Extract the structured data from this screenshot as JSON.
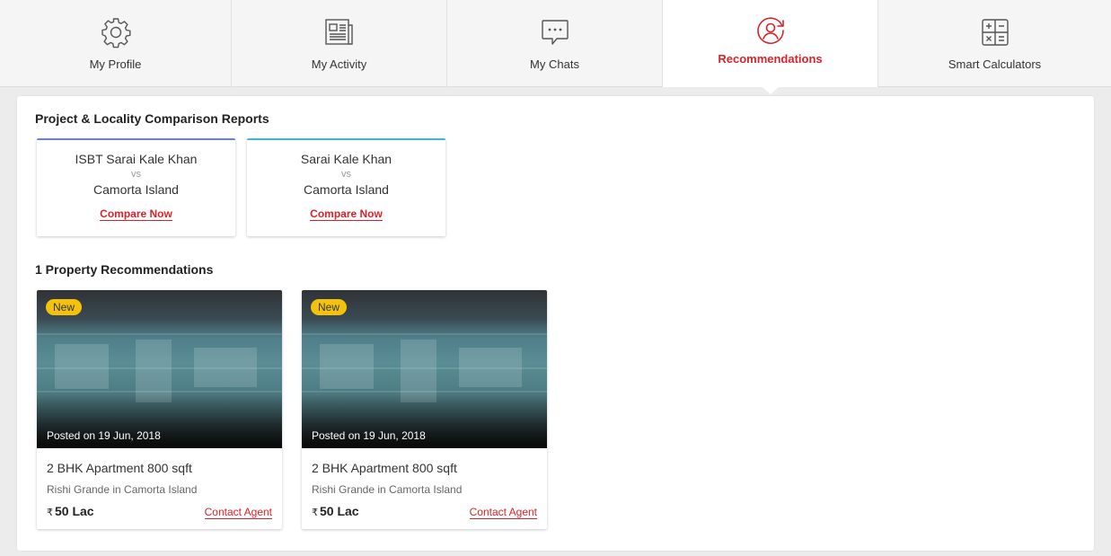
{
  "tabs": [
    {
      "label": "My Profile",
      "icon": "gear-icon"
    },
    {
      "label": "My Activity",
      "icon": "newspaper-icon"
    },
    {
      "label": "My Chats",
      "icon": "chat-bubble-icon"
    },
    {
      "label": "Recommendations",
      "icon": "user-refresh-icon",
      "active": true
    },
    {
      "label": "Smart Calculators",
      "icon": "calculator-icon"
    }
  ],
  "colors": {
    "accent": "#d8232a",
    "badge": "#f4c20d",
    "compare_bar_1": "#6f7fc8",
    "compare_bar_2": "#3fb7c6"
  },
  "comparison": {
    "title": "Project & Locality Comparison Reports",
    "cards": [
      {
        "a": "ISBT Sarai Kale Khan",
        "vs": "vs",
        "b": "Camorta Island",
        "link": "Compare Now"
      },
      {
        "a": "Sarai Kale Khan",
        "vs": "vs",
        "b": "Camorta Island",
        "link": "Compare Now"
      }
    ]
  },
  "recommendations": {
    "title": "1 Property Recommendations",
    "cards": [
      {
        "badge": "New",
        "posted": "Posted on 19 Jun, 2018",
        "title": "2 BHK Apartment 800 sqft",
        "subtitle": "Rishi Grande in Camorta Island",
        "currency": "₹",
        "price": "50 Lac",
        "action": "Contact Agent"
      },
      {
        "badge": "New",
        "posted": "Posted on 19 Jun, 2018",
        "title": "2 BHK Apartment 800 sqft",
        "subtitle": "Rishi Grande in Camorta Island",
        "currency": "₹",
        "price": "50 Lac",
        "action": "Contact Agent"
      }
    ]
  }
}
